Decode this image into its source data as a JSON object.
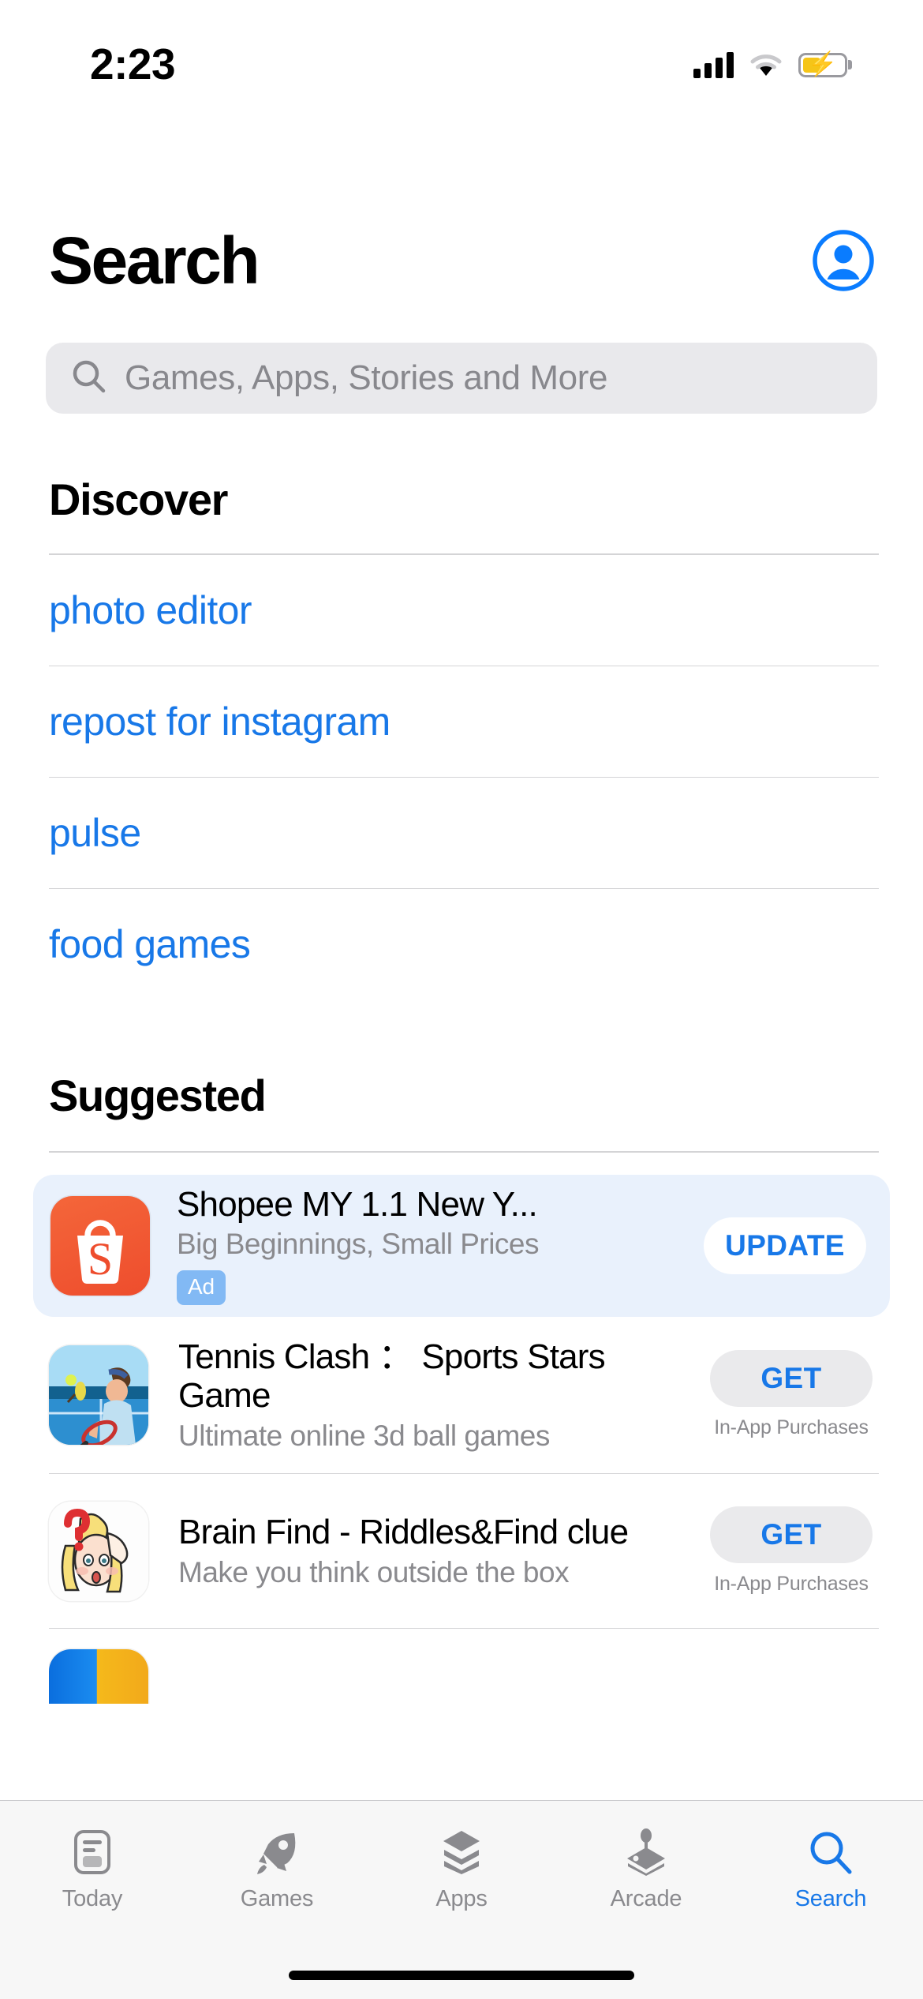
{
  "status_bar": {
    "time": "2:23",
    "signal_icon": "cellular-bars-icon",
    "wifi_icon": "wifi-icon",
    "battery_icon": "battery-charging-icon",
    "battery_color": "#f5c518"
  },
  "header": {
    "title": "Search",
    "account_icon": "account-circle-icon",
    "accent_color": "#1878e8"
  },
  "search": {
    "placeholder": "Games, Apps, Stories and More",
    "icon": "search-icon",
    "value": ""
  },
  "discover": {
    "title": "Discover",
    "items": [
      {
        "label": "photo editor"
      },
      {
        "label": "repost for instagram"
      },
      {
        "label": "pulse"
      },
      {
        "label": "food games"
      }
    ]
  },
  "suggested": {
    "title": "Suggested",
    "ad": {
      "name": "Shopee MY 1.1 New Y...",
      "subtitle": "Big Beginnings, Small Prices",
      "badge": "Ad",
      "action_label": "UPDATE",
      "icon": "shopee-app-icon"
    },
    "apps": [
      {
        "name": "Tennis Clash ： Sports Stars Game",
        "subtitle": "Ultimate online 3d ball games",
        "action_label": "GET",
        "iap_note": "In-App Purchases",
        "icon": "tennis-clash-app-icon"
      },
      {
        "name": "Brain Find - Riddles&Find clue",
        "subtitle": "Make you think outside the box",
        "action_label": "GET",
        "iap_note": "In-App Purchases",
        "icon": "brain-find-app-icon"
      }
    ]
  },
  "tab_bar": {
    "tabs": [
      {
        "label": "Today",
        "icon": "today-card-icon",
        "active": false
      },
      {
        "label": "Games",
        "icon": "rocket-icon",
        "active": false
      },
      {
        "label": "Apps",
        "icon": "stacked-apps-icon",
        "active": false
      },
      {
        "label": "Arcade",
        "icon": "joystick-icon",
        "active": false
      },
      {
        "label": "Search",
        "icon": "search-icon",
        "active": true
      }
    ]
  }
}
